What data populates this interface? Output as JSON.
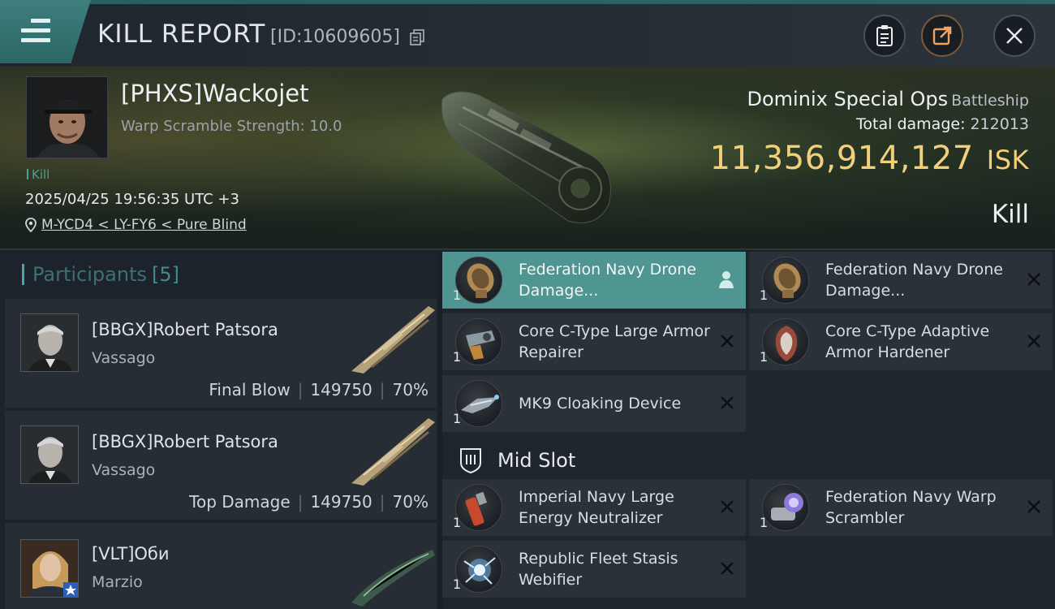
{
  "header": {
    "title": "KILL REPORT",
    "report_id": "[ID:10609605]"
  },
  "victim": {
    "name": "[PHXS]Wackojet",
    "warp_scramble": "Warp Scramble Strength: 10.0",
    "tag": "Kill",
    "datetime": "2025/04/25 19:56:35 UTC +3",
    "location": "M-YCD4 < LY-FY6 < Pure Blind",
    "ship_name": "Dominix Special Ops",
    "ship_class": "Battleship",
    "total_damage_label": "Total damage:",
    "total_damage": "212013",
    "isk_value": "11,356,914,127",
    "isk_unit": "ISK",
    "result": "Kill"
  },
  "participants": {
    "label": "Participants",
    "count": "[5]",
    "rows": [
      {
        "name": "[BBGX]Robert Patsora",
        "ship": "Vassago",
        "role": "Final Blow",
        "damage": "149750",
        "percent": "70%"
      },
      {
        "name": "[BBGX]Robert Patsora",
        "ship": "Vassago",
        "role": "Top Damage",
        "damage": "149750",
        "percent": "70%"
      },
      {
        "name": "[VLT]Оби",
        "ship": "Marzio"
      }
    ]
  },
  "modules": {
    "top": [
      {
        "qty": "1",
        "name": "Federation Navy Drone Damage..."
      },
      {
        "qty": "1",
        "name": "Federation Navy Drone Damage..."
      },
      {
        "qty": "1",
        "name": "Core C-Type Large Armor Repairer"
      },
      {
        "qty": "1",
        "name": "Core C-Type Adaptive Armor Hardener"
      },
      {
        "qty": "1",
        "name": "MK9 Cloaking Device"
      }
    ],
    "mid_slot_label": "Mid Slot",
    "mid": [
      {
        "qty": "1",
        "name": "Imperial Navy Large Energy Neutralizer"
      },
      {
        "qty": "1",
        "name": "Federation Navy Warp Scrambler"
      },
      {
        "qty": "1",
        "name": "Republic Fleet Stasis Webifier"
      }
    ]
  },
  "colors": {
    "accent": "#4f9591",
    "isk": "#f2cf7a"
  }
}
